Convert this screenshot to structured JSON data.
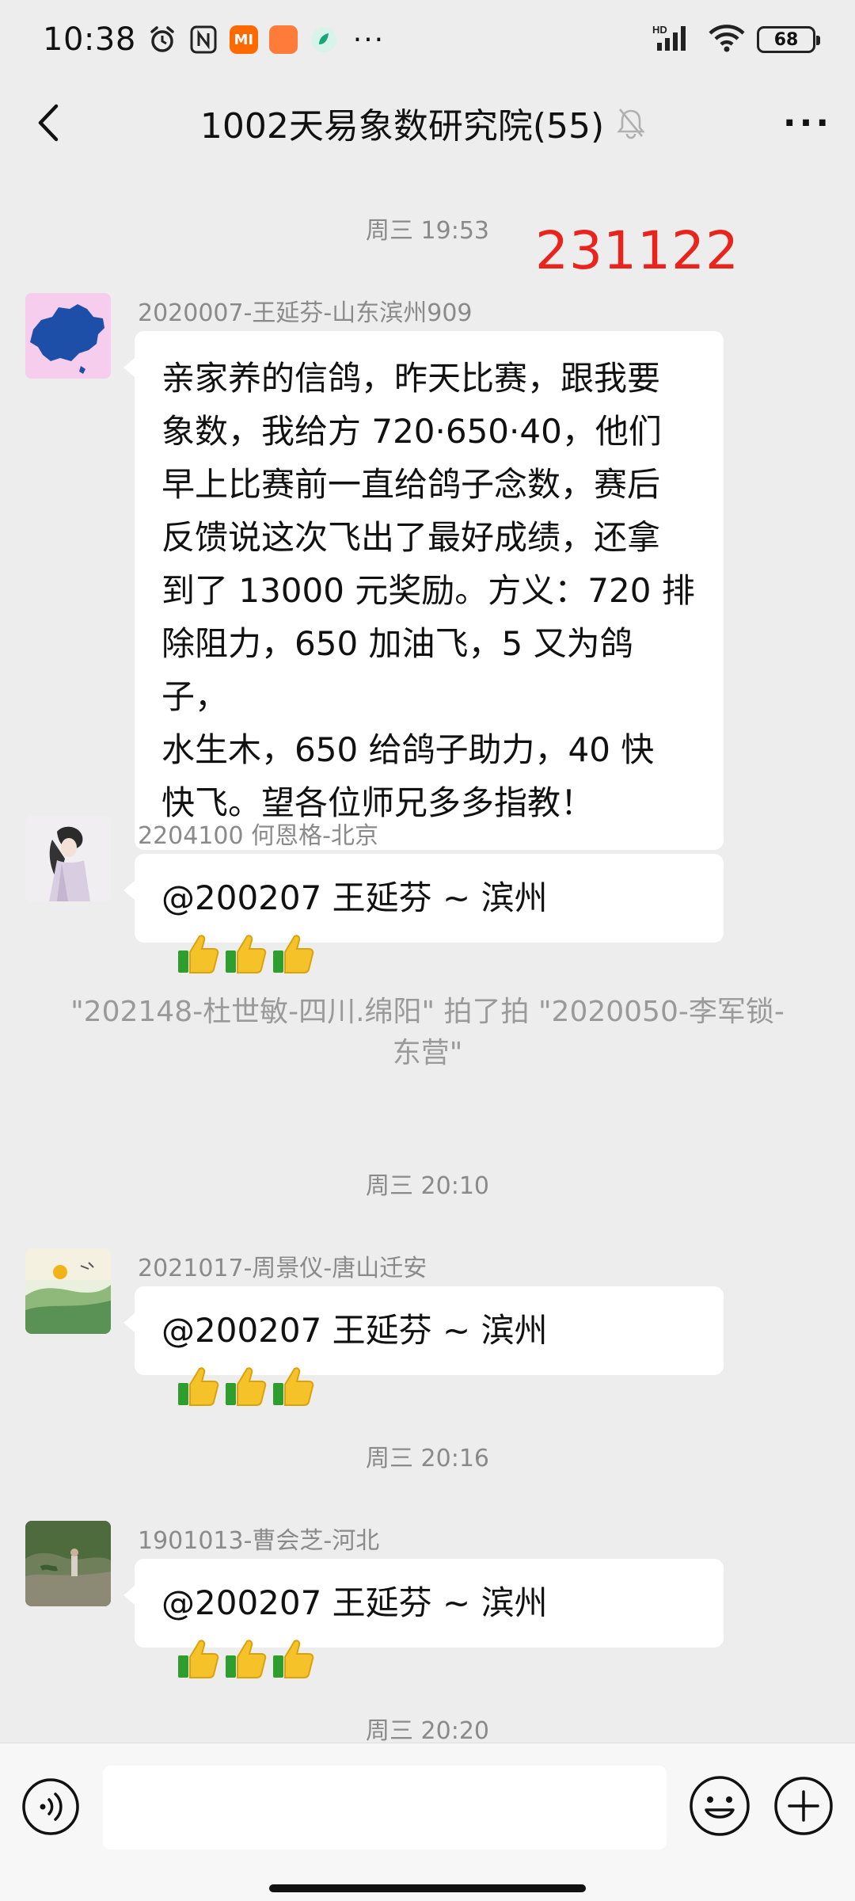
{
  "status_bar": {
    "time": "10:38",
    "mi_label": "MI",
    "network": "HD",
    "battery": "68"
  },
  "header": {
    "title": "1002天易象数研究院(55)",
    "more": "···"
  },
  "watermark": "231122",
  "timestamps": [
    "周三 19:53",
    "周三 20:10",
    "周三 20:16",
    "周三 20:20"
  ],
  "messages": [
    {
      "sender": "2020007-王延芬-山东滨州909",
      "lines": [
        "亲家养的信鸽，昨天比赛，跟我要",
        "象数，我给方 720·650·40，他们",
        "早上比赛前一直给鸽子念数，赛后",
        "反馈说这次飞出了最好成绩，还拿",
        "到了 13000 元奖励。方义：720 排",
        "除阻力，650 加油飞，5 又为鸽子，",
        "水生木，650 给鸽子助力，40 快",
        "快飞。望各位师兄多多指教！"
      ]
    },
    {
      "sender": "2204100 何恩格-北京",
      "text": "@200207 王延芬 ~ 滨州"
    },
    {
      "sender": "2021017-周景仪-唐山迁安",
      "text": "@200207 王延芬 ~ 滨州"
    },
    {
      "sender": "1901013-曹会芝-河北",
      "text": "@200207 王延芬 ~ 滨州"
    }
  ],
  "system_note": {
    "line1": "\"202148-杜世敏-四川.绵阳\" 拍了拍 \"2020050-李军锁-",
    "line2": "东营\""
  },
  "input": {
    "placeholder": ""
  },
  "colors": {
    "background": "#ededed",
    "bubble": "#ffffff",
    "watermark": "#e8241d",
    "meta_text": "#8a8a8a"
  }
}
